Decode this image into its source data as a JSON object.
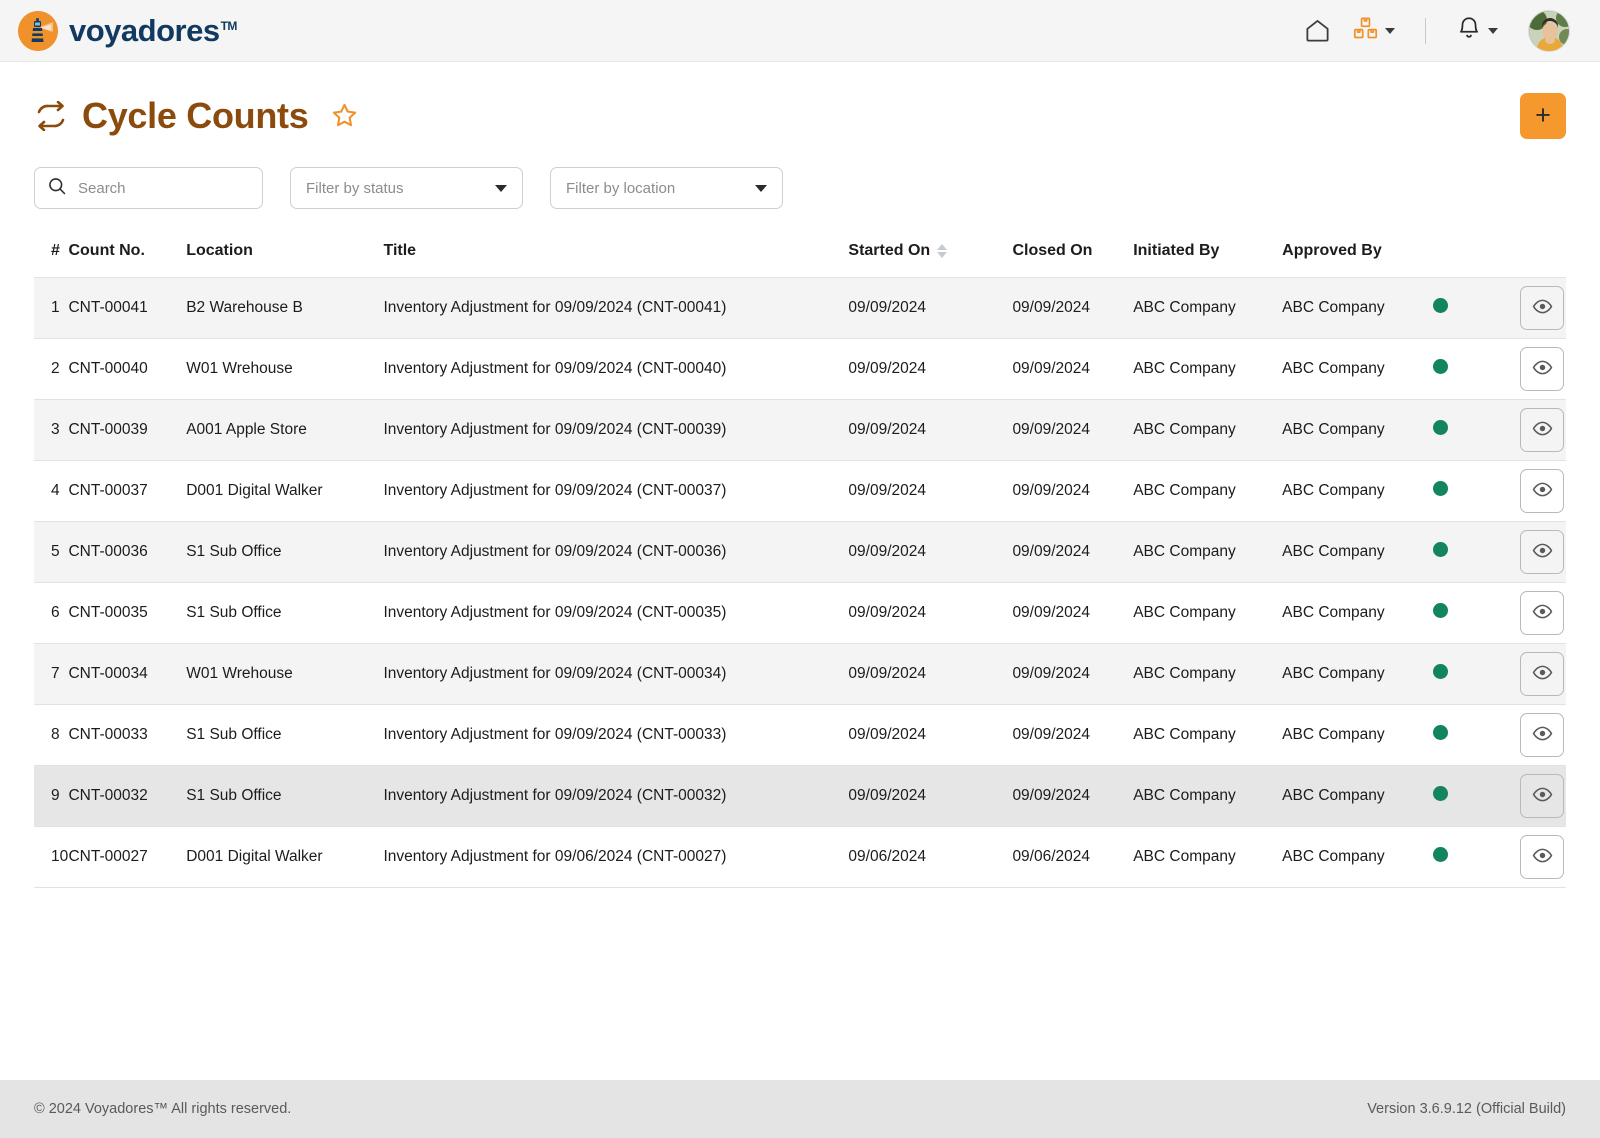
{
  "brand": {
    "name": "voyadores",
    "tm": "TM",
    "logo_icon": "lighthouse-icon",
    "logo_bg": "#f0912c",
    "text_color": "#123a61"
  },
  "topbar": {
    "home_icon": "home-icon",
    "inventory_icon": "boxes-icon",
    "inventory_caret_icon": "chevron-down-icon",
    "notifications_icon": "bell-icon",
    "notifications_caret_icon": "chevron-down-icon",
    "avatar_icon": "user-avatar",
    "accent": "#f0912c"
  },
  "header": {
    "title": "Cycle Counts",
    "title_icon": "cycle-arrows-icon",
    "favorite_icon": "star-outline-icon",
    "title_color": "#8a4b0c",
    "add_label": "+",
    "add_color": "#f5992e"
  },
  "filters": {
    "search_placeholder": "Search",
    "search_value": "",
    "search_icon": "search-icon",
    "status_label": "Filter by status",
    "location_label": "Filter by location",
    "caret_icon": "caret-down-icon"
  },
  "table": {
    "columns": [
      {
        "key": "idx",
        "label": "#"
      },
      {
        "key": "count_no",
        "label": "Count No."
      },
      {
        "key": "location",
        "label": "Location"
      },
      {
        "key": "title",
        "label": "Title"
      },
      {
        "key": "started_on",
        "label": "Started On",
        "sortable": true
      },
      {
        "key": "closed_on",
        "label": "Closed On"
      },
      {
        "key": "initiated_by",
        "label": "Initiated By"
      },
      {
        "key": "approved_by",
        "label": "Approved By"
      }
    ],
    "status_color": "#12855c",
    "action_icon": "eye-icon",
    "rows": [
      {
        "idx": "1",
        "count_no": "CNT-00041",
        "location": "B2 Warehouse B",
        "title": "Inventory Adjustment for 09/09/2024 (CNT-00041)",
        "started_on": "09/09/2024",
        "closed_on": "09/09/2024",
        "initiated_by": "ABC Company",
        "approved_by": "ABC Company"
      },
      {
        "idx": "2",
        "count_no": "CNT-00040",
        "location": "W01 Wrehouse",
        "title": "Inventory Adjustment for 09/09/2024 (CNT-00040)",
        "started_on": "09/09/2024",
        "closed_on": "09/09/2024",
        "initiated_by": "ABC Company",
        "approved_by": "ABC Company"
      },
      {
        "idx": "3",
        "count_no": "CNT-00039",
        "location": "A001 Apple Store",
        "title": "Inventory Adjustment for 09/09/2024 (CNT-00039)",
        "started_on": "09/09/2024",
        "closed_on": "09/09/2024",
        "initiated_by": "ABC Company",
        "approved_by": "ABC Company"
      },
      {
        "idx": "4",
        "count_no": "CNT-00037",
        "location": "D001 Digital Walker",
        "title": "Inventory Adjustment for 09/09/2024 (CNT-00037)",
        "started_on": "09/09/2024",
        "closed_on": "09/09/2024",
        "initiated_by": "ABC Company",
        "approved_by": "ABC Company"
      },
      {
        "idx": "5",
        "count_no": "CNT-00036",
        "location": "S1 Sub Office",
        "title": "Inventory Adjustment for 09/09/2024 (CNT-00036)",
        "started_on": "09/09/2024",
        "closed_on": "09/09/2024",
        "initiated_by": "ABC Company",
        "approved_by": "ABC Company"
      },
      {
        "idx": "6",
        "count_no": "CNT-00035",
        "location": "S1 Sub Office",
        "title": "Inventory Adjustment for 09/09/2024 (CNT-00035)",
        "started_on": "09/09/2024",
        "closed_on": "09/09/2024",
        "initiated_by": "ABC Company",
        "approved_by": "ABC Company"
      },
      {
        "idx": "7",
        "count_no": "CNT-00034",
        "location": "W01 Wrehouse",
        "title": "Inventory Adjustment for 09/09/2024 (CNT-00034)",
        "started_on": "09/09/2024",
        "closed_on": "09/09/2024",
        "initiated_by": "ABC Company",
        "approved_by": "ABC Company"
      },
      {
        "idx": "8",
        "count_no": "CNT-00033",
        "location": "S1 Sub Office",
        "title": "Inventory Adjustment for 09/09/2024 (CNT-00033)",
        "started_on": "09/09/2024",
        "closed_on": "09/09/2024",
        "initiated_by": "ABC Company",
        "approved_by": "ABC Company"
      },
      {
        "idx": "9",
        "count_no": "CNT-00032",
        "location": "S1 Sub Office",
        "title": "Inventory Adjustment for 09/09/2024 (CNT-00032)",
        "started_on": "09/09/2024",
        "closed_on": "09/09/2024",
        "initiated_by": "ABC Company",
        "approved_by": "ABC Company"
      },
      {
        "idx": "10",
        "count_no": "CNT-00027",
        "location": "D001 Digital Walker",
        "title": "Inventory Adjustment for 09/06/2024 (CNT-00027)",
        "started_on": "09/06/2024",
        "closed_on": "09/06/2024",
        "initiated_by": "ABC Company",
        "approved_by": "ABC Company"
      }
    ]
  },
  "footer": {
    "copyright": "© 2024 Voyadores™ All rights reserved.",
    "version": "Version 3.6.9.12 (Official Build)"
  }
}
